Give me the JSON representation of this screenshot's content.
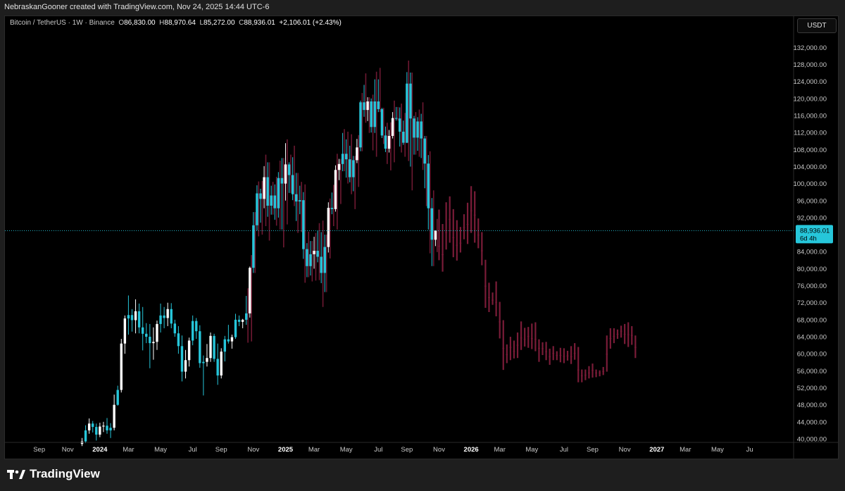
{
  "header": {
    "created_by": "NebraskanGooner created with TradingView.com, Nov 24, 2025 14:44 UTC-6"
  },
  "legend": {
    "symbol": "Bitcoin / TetherUS · 1W · Binance",
    "open_label": "O",
    "open": "86,830.00",
    "high_label": "H",
    "high": "88,970.64",
    "low_label": "L",
    "low": "85,272.00",
    "close_label": "C",
    "close": "88,936.01",
    "change": "+2,106.01 (+2.43%)"
  },
  "currency_button": "USDT",
  "last_price": {
    "value": "88,936.01",
    "countdown": "6d 4h"
  },
  "brand": {
    "name": "TradingView"
  },
  "colors": {
    "up_white": "#ffffff",
    "up_cyan": "#26c6da",
    "down_red": "#7a1c38",
    "price_line": "#26c6da",
    "background": "#000000"
  },
  "chart_data": {
    "type": "candlestick",
    "interval": "1W",
    "y_unit": "USDT",
    "ylim": [
      38000,
      134000
    ],
    "yticks": [
      40000,
      44000,
      48000,
      52000,
      56000,
      60000,
      64000,
      68000,
      72000,
      76000,
      80000,
      84000,
      88000,
      92000,
      96000,
      100000,
      104000,
      108000,
      112000,
      116000,
      120000,
      124000,
      128000,
      132000
    ],
    "ytick_labels": [
      "40,000.00",
      "44,000.00",
      "48,000.00",
      "52,000.00",
      "56,000.00",
      "60,000.00",
      "64,000.00",
      "68,000.00",
      "72,000.00",
      "76,000.00",
      "80,000.00",
      "84,000.00",
      "88,000.00",
      "92,000.00",
      "96,000.00",
      "100,000.00",
      "104,000.00",
      "108,000.00",
      "112,000.00",
      "116,000.00",
      "120,000.00",
      "124,000.00",
      "128,000.00",
      "132,000.00"
    ],
    "xtick_labels": [
      "Sep",
      "Nov",
      "2024",
      "Mar",
      "May",
      "Jul",
      "Sep",
      "Nov",
      "2025",
      "Mar",
      "May",
      "Jul",
      "Sep",
      "Nov",
      "2026",
      "Mar",
      "May",
      "Jul",
      "Sep",
      "Nov",
      "2027",
      "Mar",
      "May",
      "Ju"
    ],
    "xtick_bold": [
      false,
      false,
      true,
      false,
      false,
      false,
      false,
      false,
      true,
      false,
      false,
      false,
      false,
      false,
      true,
      false,
      false,
      false,
      false,
      false,
      true,
      false,
      false,
      false
    ],
    "xtick_week_index": [
      -12,
      -4,
      5,
      13,
      22,
      31,
      39,
      48,
      57,
      65,
      74,
      83,
      91,
      100,
      109,
      117,
      126,
      135,
      143,
      152,
      161,
      169,
      178,
      187
    ],
    "last_close": 88936.01,
    "candles": [
      {
        "o": 38800,
        "h": 40200,
        "l": 38300,
        "c": 39400
      },
      {
        "o": 39400,
        "h": 43200,
        "l": 39000,
        "c": 42000
      },
      {
        "o": 42000,
        "h": 44800,
        "l": 41200,
        "c": 43600
      },
      {
        "o": 43600,
        "h": 44200,
        "l": 41500,
        "c": 42800
      },
      {
        "o": 42800,
        "h": 43600,
        "l": 39600,
        "c": 41000
      },
      {
        "o": 41000,
        "h": 43800,
        "l": 40400,
        "c": 42900
      },
      {
        "o": 42900,
        "h": 44000,
        "l": 41600,
        "c": 43100
      },
      {
        "o": 43100,
        "h": 44900,
        "l": 41200,
        "c": 42000
      },
      {
        "o": 42000,
        "h": 43700,
        "l": 40200,
        "c": 42600
      },
      {
        "o": 42600,
        "h": 50400,
        "l": 42000,
        "c": 48000
      },
      {
        "o": 48000,
        "h": 52500,
        "l": 47800,
        "c": 51500
      },
      {
        "o": 51500,
        "h": 63500,
        "l": 50900,
        "c": 62400
      },
      {
        "o": 62400,
        "h": 69000,
        "l": 60000,
        "c": 68300
      },
      {
        "o": 68300,
        "h": 73700,
        "l": 64500,
        "c": 69100
      },
      {
        "o": 69100,
        "h": 70500,
        "l": 65200,
        "c": 67900
      },
      {
        "o": 67900,
        "h": 72800,
        "l": 64800,
        "c": 70000
      },
      {
        "o": 70000,
        "h": 71800,
        "l": 64800,
        "c": 66200
      },
      {
        "o": 66200,
        "h": 71000,
        "l": 60800,
        "c": 64700
      },
      {
        "o": 64700,
        "h": 67200,
        "l": 62500,
        "c": 64000
      },
      {
        "o": 64000,
        "h": 67000,
        "l": 56600,
        "c": 62500
      },
      {
        "o": 62500,
        "h": 66200,
        "l": 58600,
        "c": 62800
      },
      {
        "o": 62800,
        "h": 67800,
        "l": 60900,
        "c": 67000
      },
      {
        "o": 67000,
        "h": 71800,
        "l": 65000,
        "c": 69000
      },
      {
        "o": 69000,
        "h": 71000,
        "l": 66000,
        "c": 68400
      },
      {
        "o": 68400,
        "h": 72000,
        "l": 66500,
        "c": 70500
      },
      {
        "o": 70500,
        "h": 71900,
        "l": 66000,
        "c": 67100
      },
      {
        "o": 67100,
        "h": 68000,
        "l": 64000,
        "c": 64800
      },
      {
        "o": 64800,
        "h": 66500,
        "l": 60000,
        "c": 61800
      },
      {
        "o": 61800,
        "h": 64300,
        "l": 53500,
        "c": 55800
      },
      {
        "o": 55800,
        "h": 60900,
        "l": 54200,
        "c": 58500
      },
      {
        "o": 58500,
        "h": 63800,
        "l": 57000,
        "c": 63100
      },
      {
        "o": 63100,
        "h": 69000,
        "l": 62000,
        "c": 67700
      },
      {
        "o": 67700,
        "h": 68400,
        "l": 63500,
        "c": 65300
      },
      {
        "o": 65300,
        "h": 66700,
        "l": 56700,
        "c": 57800
      },
      {
        "o": 57800,
        "h": 59600,
        "l": 50200,
        "c": 58100
      },
      {
        "o": 58100,
        "h": 62300,
        "l": 57000,
        "c": 59000
      },
      {
        "o": 59000,
        "h": 65000,
        "l": 58100,
        "c": 64200
      },
      {
        "o": 64200,
        "h": 64700,
        "l": 58100,
        "c": 58800
      },
      {
        "o": 58800,
        "h": 62400,
        "l": 52700,
        "c": 54900
      },
      {
        "o": 54900,
        "h": 61300,
        "l": 54200,
        "c": 60500
      },
      {
        "o": 60500,
        "h": 64200,
        "l": 58200,
        "c": 63400
      },
      {
        "o": 63400,
        "h": 66800,
        "l": 62400,
        "c": 62900
      },
      {
        "o": 62900,
        "h": 64500,
        "l": 61200,
        "c": 63900
      },
      {
        "o": 63900,
        "h": 69400,
        "l": 63500,
        "c": 68000
      },
      {
        "o": 68000,
        "h": 69000,
        "l": 66500,
        "c": 67500
      },
      {
        "o": 67500,
        "h": 68200,
        "l": 66000,
        "c": 68000
      },
      {
        "o": 68000,
        "h": 73600,
        "l": 66800,
        "c": 69500
      },
      {
        "o": 69500,
        "h": 80500,
        "l": 68500,
        "c": 80200
      },
      {
        "o": 80200,
        "h": 93300,
        "l": 79000,
        "c": 90200
      },
      {
        "o": 90200,
        "h": 99600,
        "l": 89000,
        "c": 97700
      },
      {
        "o": 97700,
        "h": 98800,
        "l": 90800,
        "c": 96400
      },
      {
        "o": 96400,
        "h": 104100,
        "l": 94200,
        "c": 101500
      },
      {
        "o": 101500,
        "h": 105000,
        "l": 92200,
        "c": 94800
      },
      {
        "o": 94800,
        "h": 99500,
        "l": 92700,
        "c": 97200
      },
      {
        "o": 97200,
        "h": 99800,
        "l": 91500,
        "c": 94200
      },
      {
        "o": 94200,
        "h": 102700,
        "l": 92000,
        "c": 101300
      },
      {
        "o": 101300,
        "h": 106000,
        "l": 89200,
        "c": 100000
      },
      {
        "o": 100000,
        "h": 109500,
        "l": 96000,
        "c": 104500
      },
      {
        "o": 104500,
        "h": 105000,
        "l": 97800,
        "c": 102000
      },
      {
        "o": 102000,
        "h": 106200,
        "l": 96100,
        "c": 97500
      },
      {
        "o": 97500,
        "h": 102500,
        "l": 91200,
        "c": 95800
      },
      {
        "o": 95800,
        "h": 99500,
        "l": 92800,
        "c": 96100
      },
      {
        "o": 96100,
        "h": 98000,
        "l": 82300,
        "c": 84600
      },
      {
        "o": 84600,
        "h": 86000,
        "l": 78000,
        "c": 80600
      },
      {
        "o": 80600,
        "h": 86500,
        "l": 78400,
        "c": 83400
      },
      {
        "o": 83400,
        "h": 87500,
        "l": 80000,
        "c": 84200
      },
      {
        "o": 84200,
        "h": 88900,
        "l": 81500,
        "c": 82800
      },
      {
        "o": 82800,
        "h": 88600,
        "l": 76600,
        "c": 79000
      },
      {
        "o": 79000,
        "h": 88000,
        "l": 74500,
        "c": 85100
      },
      {
        "o": 85100,
        "h": 95600,
        "l": 83800,
        "c": 94300
      },
      {
        "o": 94300,
        "h": 97900,
        "l": 92800,
        "c": 94000
      },
      {
        "o": 94000,
        "h": 104300,
        "l": 93400,
        "c": 103200
      },
      {
        "o": 103200,
        "h": 105800,
        "l": 100800,
        "c": 104600
      },
      {
        "o": 104600,
        "h": 111900,
        "l": 102900,
        "c": 107000
      },
      {
        "o": 107000,
        "h": 110400,
        "l": 101400,
        "c": 105700
      },
      {
        "o": 105700,
        "h": 108900,
        "l": 100300,
        "c": 101500
      },
      {
        "o": 101500,
        "h": 106500,
        "l": 98200,
        "c": 105500
      },
      {
        "o": 105500,
        "h": 110500,
        "l": 104800,
        "c": 108500
      },
      {
        "o": 108500,
        "h": 119500,
        "l": 107600,
        "c": 119100
      },
      {
        "o": 119100,
        "h": 123200,
        "l": 115700,
        "c": 117300
      },
      {
        "o": 117300,
        "h": 120300,
        "l": 114700,
        "c": 119300
      },
      {
        "o": 119300,
        "h": 120000,
        "l": 112000,
        "c": 113300
      },
      {
        "o": 113300,
        "h": 124500,
        "l": 111900,
        "c": 119300
      },
      {
        "o": 119300,
        "h": 124500,
        "l": 116800,
        "c": 117500
      },
      {
        "o": 117500,
        "h": 117800,
        "l": 110700,
        "c": 111300
      },
      {
        "o": 111300,
        "h": 113400,
        "l": 107400,
        "c": 108200
      },
      {
        "o": 108200,
        "h": 112600,
        "l": 107300,
        "c": 111200
      },
      {
        "o": 111200,
        "h": 116800,
        "l": 110600,
        "c": 115400
      },
      {
        "o": 115400,
        "h": 118000,
        "l": 114800,
        "c": 115300
      },
      {
        "o": 115300,
        "h": 117900,
        "l": 108700,
        "c": 112200
      },
      {
        "o": 112200,
        "h": 114800,
        "l": 109100,
        "c": 109600
      },
      {
        "o": 109600,
        "h": 126200,
        "l": 109500,
        "c": 123500
      },
      {
        "o": 123500,
        "h": 126100,
        "l": 104000,
        "c": 115300
      },
      {
        "o": 115300,
        "h": 115900,
        "l": 106800,
        "c": 110800
      },
      {
        "o": 110800,
        "h": 115600,
        "l": 107700,
        "c": 114600
      },
      {
        "o": 114600,
        "h": 116400,
        "l": 106000,
        "c": 110600
      },
      {
        "o": 110600,
        "h": 111200,
        "l": 98900,
        "c": 104700
      },
      {
        "o": 104700,
        "h": 106700,
        "l": 89200,
        "c": 94200
      },
      {
        "o": 94200,
        "h": 96600,
        "l": 80600,
        "c": 86800
      },
      {
        "o": 86800,
        "h": 89000,
        "l": 85300,
        "c": 88936.01
      }
    ],
    "projection": [
      {
        "h": 93900,
        "l": 82000,
        "c": 85300
      },
      {
        "h": 90500,
        "l": 79300,
        "c": 83300
      },
      {
        "h": 95600,
        "l": 84500,
        "c": 88500
      },
      {
        "h": 97000,
        "l": 86100,
        "c": 91600
      },
      {
        "h": 94000,
        "l": 82700,
        "c": 87300
      },
      {
        "h": 91400,
        "l": 81900,
        "c": 85500
      },
      {
        "h": 89800,
        "l": 83800,
        "c": 86000
      },
      {
        "h": 92800,
        "l": 86900,
        "c": 89700
      },
      {
        "h": 95500,
        "l": 85800,
        "c": 90400
      },
      {
        "h": 99400,
        "l": 88400,
        "c": 93600
      },
      {
        "h": 98200,
        "l": 86100,
        "c": 92600
      },
      {
        "h": 91800,
        "l": 84800,
        "c": 87900
      },
      {
        "h": 88600,
        "l": 80800,
        "c": 84200
      },
      {
        "h": 82100,
        "l": 70800,
        "c": 75900
      },
      {
        "h": 76700,
        "l": 69800,
        "c": 73200
      },
      {
        "h": 74400,
        "l": 71500,
        "c": 72600
      },
      {
        "h": 77000,
        "l": 68800,
        "c": 72100
      },
      {
        "h": 72200,
        "l": 63600,
        "c": 67500
      },
      {
        "h": 67900,
        "l": 56200,
        "c": 61300
      },
      {
        "h": 62200,
        "l": 57800,
        "c": 59800
      },
      {
        "h": 64000,
        "l": 58500,
        "c": 61500
      },
      {
        "h": 63100,
        "l": 58900,
        "c": 60600
      },
      {
        "h": 65000,
        "l": 59000,
        "c": 62000
      },
      {
        "h": 67600,
        "l": 60900,
        "c": 63700
      },
      {
        "h": 66100,
        "l": 61700,
        "c": 63400
      },
      {
        "h": 66300,
        "l": 61400,
        "c": 64100
      },
      {
        "h": 67100,
        "l": 61100,
        "c": 63600
      },
      {
        "h": 67400,
        "l": 60600,
        "c": 63400
      },
      {
        "h": 63400,
        "l": 58100,
        "c": 61300
      },
      {
        "h": 62700,
        "l": 59700,
        "c": 61200
      },
      {
        "h": 62800,
        "l": 58500,
        "c": 60500
      },
      {
        "h": 61200,
        "l": 57400,
        "c": 59300
      },
      {
        "h": 61800,
        "l": 58500,
        "c": 60100
      },
      {
        "h": 60600,
        "l": 58500,
        "c": 59600
      },
      {
        "h": 61400,
        "l": 58000,
        "c": 59600
      },
      {
        "h": 61300,
        "l": 57800,
        "c": 59400
      },
      {
        "h": 60700,
        "l": 58400,
        "c": 59500
      },
      {
        "h": 61800,
        "l": 57600,
        "c": 59300
      },
      {
        "h": 62500,
        "l": 58600,
        "c": 60100
      },
      {
        "h": 61600,
        "l": 53300,
        "c": 56200
      },
      {
        "h": 56300,
        "l": 53300,
        "c": 54800
      },
      {
        "h": 56300,
        "l": 53800,
        "c": 55000
      },
      {
        "h": 57100,
        "l": 54200,
        "c": 55500
      },
      {
        "h": 57700,
        "l": 54400,
        "c": 56100
      },
      {
        "h": 56300,
        "l": 54500,
        "c": 55500
      },
      {
        "h": 56100,
        "l": 54700,
        "c": 55500
      },
      {
        "h": 56900,
        "l": 55000,
        "c": 55800
      },
      {
        "h": 64300,
        "l": 55800,
        "c": 59900
      },
      {
        "h": 66000,
        "l": 61200,
        "c": 63600
      },
      {
        "h": 66000,
        "l": 62500,
        "c": 64100
      },
      {
        "h": 65700,
        "l": 63500,
        "c": 64600
      },
      {
        "h": 66600,
        "l": 63800,
        "c": 65300
      },
      {
        "h": 67000,
        "l": 62300,
        "c": 64600
      },
      {
        "h": 67400,
        "l": 61600,
        "c": 64500
      },
      {
        "h": 66500,
        "l": 62100,
        "c": 64300
      },
      {
        "h": 64300,
        "l": 59000,
        "c": 61500
      }
    ]
  }
}
